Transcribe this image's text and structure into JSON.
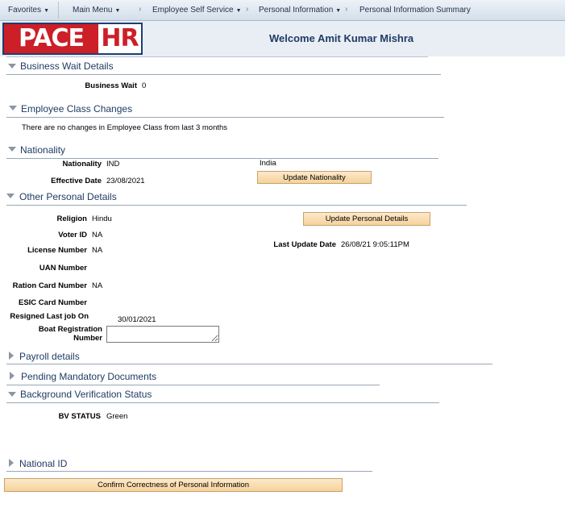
{
  "nav": {
    "favorites": "Favorites",
    "main_menu": "Main Menu",
    "ess": "Employee Self Service",
    "personal_info": "Personal Information",
    "summary": "Personal Information Summary",
    "sep": "›"
  },
  "header": {
    "logo_pace": "PACE",
    "logo_hr": "HR",
    "welcome": "Welcome Amit Kumar Mishra"
  },
  "business_wait": {
    "title": "Business Wait Details",
    "label": "Business Wait",
    "value": "0"
  },
  "employee_class": {
    "title": "Employee Class Changes",
    "message": "There are no changes in Employee Class from last 3 months"
  },
  "nationality": {
    "title": "Nationality",
    "nationality_label": "Nationality",
    "nationality_code": "IND",
    "nationality_name": "India",
    "effective_label": "Effective Date",
    "effective_value": "23/08/2021",
    "update_button": "Update Nationality"
  },
  "other_personal": {
    "title": "Other Personal Details",
    "religion_label": "Religion",
    "religion_value": "Hindu",
    "voter_label": "Voter ID",
    "voter_value": "NA",
    "license_label": "License Number",
    "license_value": "NA",
    "uan_label": "UAN Number",
    "ration_label": "Ration Card Number",
    "ration_value": "NA",
    "esic_label": "ESIC Card Number",
    "resigned_label": "Resigned Last job On",
    "resigned_value": "30/01/2021",
    "boat_label_1": "Boat Registration",
    "boat_label_2": "Number",
    "boat_value": "",
    "update_button": "Update Personal Details",
    "last_update_label": "Last Update Date",
    "last_update_value": "26/08/21  9:05:11PM"
  },
  "payroll": {
    "title": "Payroll details"
  },
  "pending_docs": {
    "title": "Pending Mandatory Documents"
  },
  "bgv": {
    "title": "Background Verification Status",
    "label": "BV STATUS",
    "value": "Green"
  },
  "national_id": {
    "title": "National ID"
  },
  "confirm_button": "Confirm Correctness of Personal Information"
}
